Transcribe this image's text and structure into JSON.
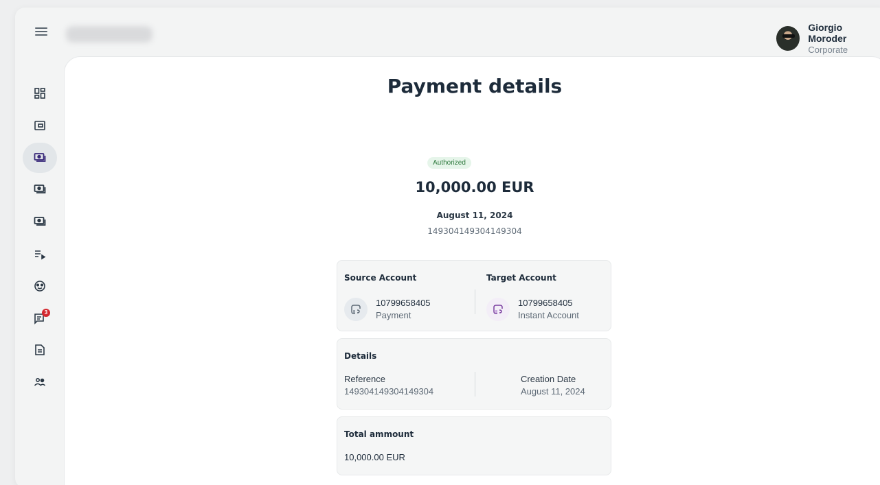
{
  "header": {
    "user_name": "Giorgio Moroder",
    "user_role": "Corporate"
  },
  "sidebar": {
    "items": [
      {
        "icon": "dashboard-icon",
        "active": false
      },
      {
        "icon": "wallet-icon",
        "active": false
      },
      {
        "icon": "payments-icon",
        "active": true
      },
      {
        "icon": "payments-icon",
        "active": false
      },
      {
        "icon": "payments-icon",
        "active": false
      },
      {
        "icon": "list-play-icon",
        "active": false
      },
      {
        "icon": "palette-icon",
        "active": false
      },
      {
        "icon": "messages-icon",
        "active": false,
        "badge": "3"
      },
      {
        "icon": "document-icon",
        "active": false
      },
      {
        "icon": "users-icon",
        "active": false
      }
    ]
  },
  "page": {
    "title": "Payment details",
    "status": "Authorized",
    "amount": "10,000.00 EUR",
    "date": "August 11, 2024",
    "reference": "149304149304149304"
  },
  "accounts": {
    "source_title": "Source Account",
    "source_number": "10799658405",
    "source_type": "Payment",
    "target_title": "Target Account",
    "target_number": "10799658405",
    "target_type": "Instant Account"
  },
  "details": {
    "title": "Details",
    "reference_label": "Reference",
    "reference_value": "149304149304149304",
    "creation_label": "Creation Date",
    "creation_value": "August 11, 2024"
  },
  "total": {
    "title": "Total ammount",
    "value": "10,000.00 EUR"
  },
  "colors": {
    "accent": "#1d2b3a",
    "status_bg": "#e6f5ea",
    "status_text": "#2f7a3e",
    "badge": "#d3282f",
    "target_icon": "#7b3fa0"
  }
}
